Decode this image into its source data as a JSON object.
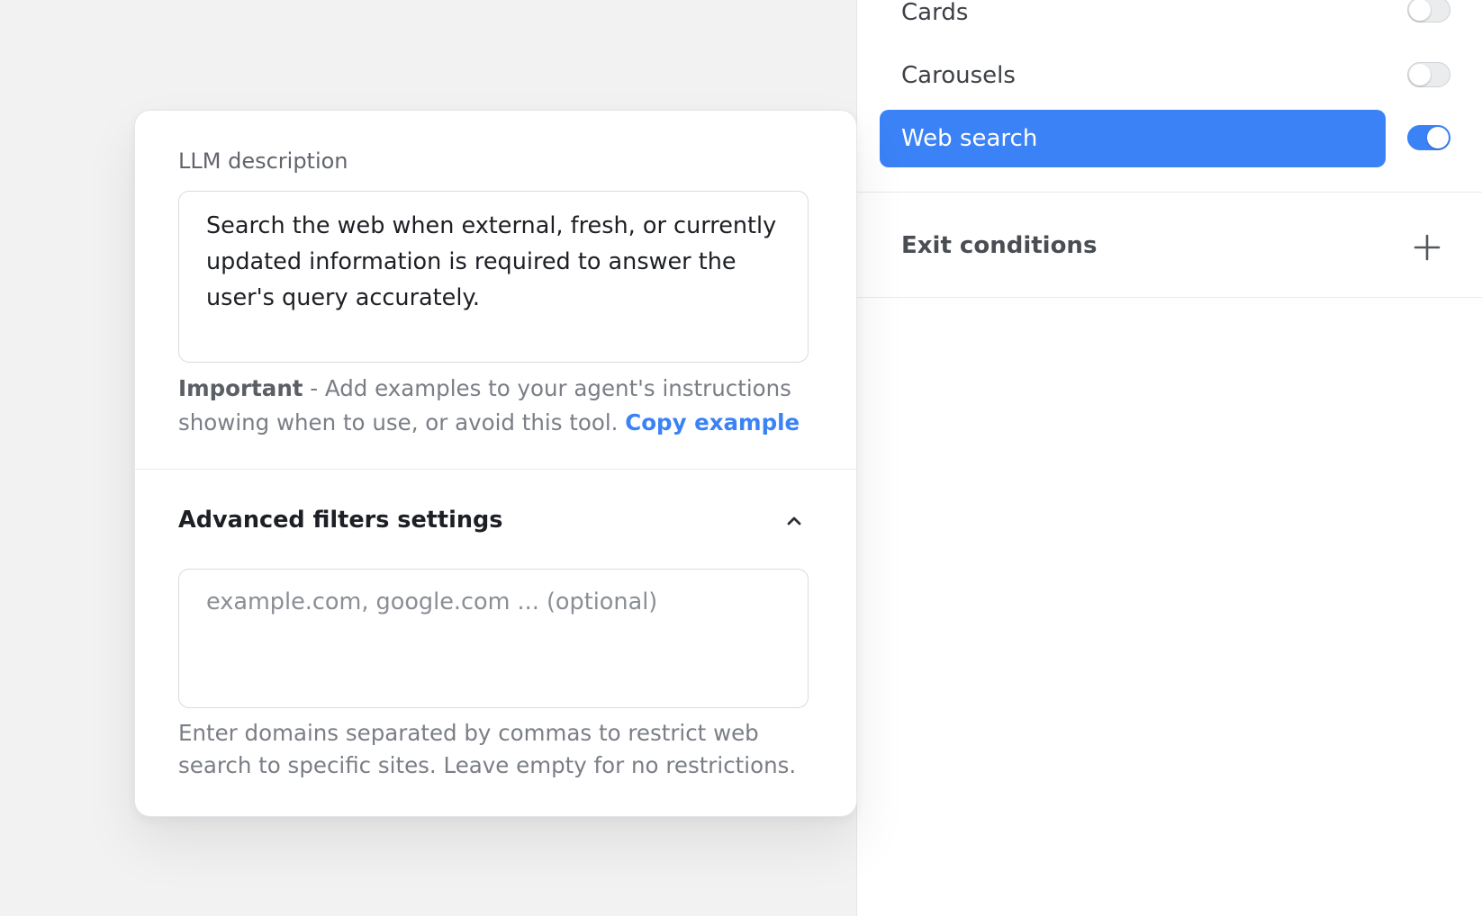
{
  "tools": {
    "items": [
      {
        "label": "Cards",
        "enabled": false
      },
      {
        "label": "Carousels",
        "enabled": false
      },
      {
        "label": "Web search",
        "enabled": true
      }
    ]
  },
  "exit_conditions": {
    "title": "Exit conditions",
    "add_icon": "plus-icon"
  },
  "card": {
    "llm_description_label": "LLM description",
    "llm_description_value": "Search the web when external, fresh, or currently updated information is required to answer the user's query accurately.",
    "hint_strong": "Important",
    "hint_text": " - Add examples to your agent's instructions showing when to use, or avoid this tool. ",
    "hint_link": "Copy example",
    "advanced_title": "Advanced filters settings",
    "collapse_icon": "chevron-up-icon",
    "domains_placeholder": "example.com, google.com ... (optional)",
    "domains_value": "",
    "domains_help": "Enter domains separated by commas to restrict web search to specific sites. Leave empty for no restrictions."
  },
  "colors": {
    "accent": "#3b82f6",
    "background": "#f1f2f1"
  }
}
